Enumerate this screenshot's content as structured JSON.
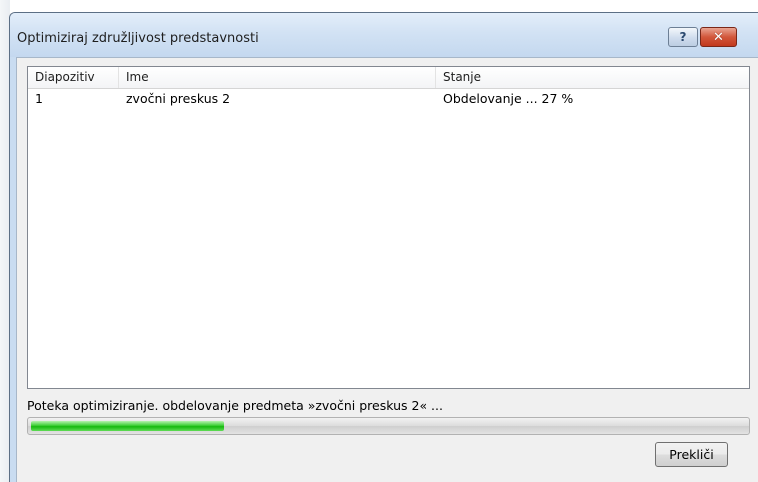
{
  "window": {
    "title": "Optimiziraj združljivost predstavnosti",
    "help_icon": "question-icon",
    "close_icon": "close-icon",
    "help_glyph": "?",
    "close_glyph": "✕"
  },
  "table": {
    "columns": [
      "Diapozitiv",
      "Ime",
      "Stanje"
    ],
    "rows": [
      {
        "slide": "1",
        "name": "zvočni preskus 2",
        "status": "Obdelovanje ... 27 %"
      }
    ]
  },
  "status_message": "Poteka optimiziranje. obdelovanje predmeta »zvočni preskus 2« ...",
  "progress": {
    "value": 0.27,
    "color": "#22c11a"
  },
  "buttons": {
    "cancel": "Prekliči"
  },
  "colors": {
    "title_bar": "#d2e2f4",
    "close_button": "#c2391d",
    "dialog_background": "#f0f0f0"
  }
}
